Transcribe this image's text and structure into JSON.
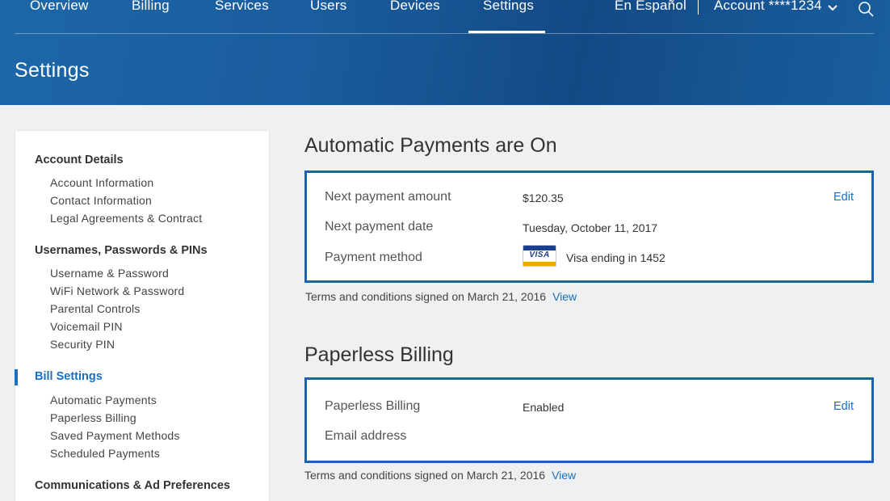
{
  "nav": {
    "items": [
      "Overview",
      "Billing",
      "Services",
      "Users",
      "Devices",
      "Settings"
    ],
    "active": "Settings",
    "language": "En Español",
    "account": "Account ****1234"
  },
  "page": {
    "title": "Settings"
  },
  "sidebar": {
    "groups": [
      {
        "label": "Account Details",
        "items": [
          "Account Information",
          "Contact Information",
          "Legal Agreements & Contract"
        ]
      },
      {
        "label": "Usernames, Passwords & PINs",
        "items": [
          "Username & Password",
          "WiFi Network & Password",
          "Parental Controls",
          "Voicemail PIN",
          "Security PIN"
        ]
      },
      {
        "label": "Bill Settings",
        "active": true,
        "items": [
          "Automatic Payments",
          "Paperless Billing",
          "Saved Payment Methods",
          "Scheduled Payments"
        ]
      },
      {
        "label": "Communications & Ad Preferences",
        "items": []
      }
    ]
  },
  "autopay": {
    "title": "Automatic Payments are On",
    "amount_label": "Next payment amount",
    "amount_value": "$120.35",
    "date_label": "Next payment date",
    "date_value": "Tuesday, October 11, 2017",
    "method_label": "Payment method",
    "card_brand": "VISA",
    "method_value": "Visa ending in 1452",
    "edit_label": "Edit",
    "terms": "Terms and conditions signed on March 21, 2016",
    "view_label": "View"
  },
  "paperless": {
    "title": "Paperless Billing",
    "status_label": "Paperless Billing",
    "status_value": "Enabled",
    "email_label": "Email address",
    "edit_label": "Edit",
    "terms": "Terms and conditions signed on March 21, 2016",
    "view_label": "View"
  },
  "colors": {
    "header_blue": "#1a5c9d",
    "accent_blue": "#1a6fbf",
    "card_border": "#1a62b4"
  },
  "icons": [
    "chevron-down-icon",
    "search-icon",
    "visa-card-icon"
  ]
}
